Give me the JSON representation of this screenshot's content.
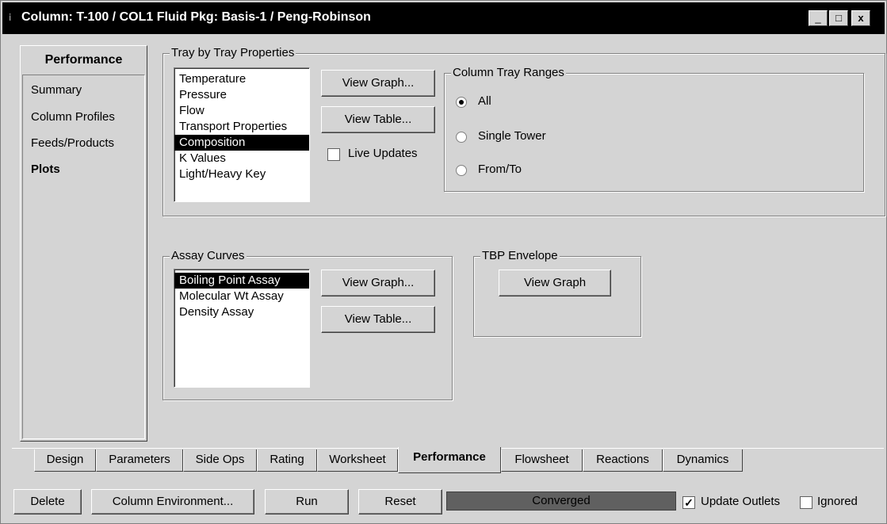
{
  "window": {
    "title": "Column: T-100 / COL1  Fluid Pkg: Basis-1 / Peng-Robinson",
    "controls": [
      "minimize-icon",
      "maximize-icon",
      "close-icon"
    ]
  },
  "nav": {
    "header": "Performance",
    "items": [
      "Summary",
      "Column Profiles",
      "Feeds/Products",
      "Plots"
    ],
    "selected": "Plots"
  },
  "tray_props": {
    "label": "Tray by Tray Properties",
    "items": [
      "Temperature",
      "Pressure",
      "Flow",
      "Transport Properties",
      "Composition",
      "K Values",
      "Light/Heavy Key"
    ],
    "selected": "Composition",
    "view_graph": "View Graph...",
    "view_table": "View Table...",
    "live_updates": "Live Updates",
    "live_updates_checked": false
  },
  "tray_ranges": {
    "label": "Column Tray Ranges",
    "options": [
      "All",
      "Single Tower",
      "From/To"
    ],
    "selected": "All"
  },
  "assay": {
    "label": "Assay Curves",
    "items": [
      "Boiling Point Assay",
      "Molecular Wt Assay",
      "Density Assay"
    ],
    "selected": "Boiling Point Assay",
    "view_graph": "View Graph...",
    "view_table": "View Table..."
  },
  "tbp": {
    "label": "TBP Envelope",
    "view_graph": "View Graph"
  },
  "tabs": [
    "Design",
    "Parameters",
    "Side Ops",
    "Rating",
    "Worksheet",
    "Performance",
    "Flowsheet",
    "Reactions",
    "Dynamics"
  ],
  "active_tab": "Performance",
  "footer": {
    "delete": "Delete",
    "column_env": "Column Environment...",
    "run": "Run",
    "reset": "Reset",
    "status": "Converged",
    "update_outlets": "Update Outlets",
    "update_outlets_checked": true,
    "ignored": "Ignored",
    "ignored_checked": false
  }
}
